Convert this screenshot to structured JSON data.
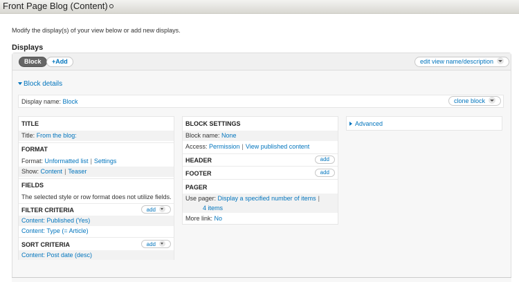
{
  "page": {
    "title": "Front Page Blog (Content)"
  },
  "intro_text": "Modify the display(s) of your view below or add new displays.",
  "displays_heading": "Displays",
  "tabs": {
    "active": "Block",
    "add_label": "+Add"
  },
  "edit_view_label": "edit view name/description",
  "block_details_label": "Block details",
  "display_name": {
    "label": "Display name:",
    "value": "Block"
  },
  "clone_label": "clone block",
  "col1": {
    "title_heading": "TITLE",
    "title_label": "Title:",
    "title_value": "From the blog:",
    "format_heading": "FORMAT",
    "format_label": "Format:",
    "format_value": "Unformatted list",
    "format_settings": "Settings",
    "show_label": "Show:",
    "show_value": "Content",
    "show_settings": "Teaser",
    "fields_heading": "FIELDS",
    "fields_note": "The selected style or row format does not utilize fields.",
    "filter_heading": "FILTER CRITERIA",
    "filter_items": [
      "Content: Published (Yes)",
      "Content: Type (= Article)"
    ],
    "sort_heading": "SORT CRITERIA",
    "sort_items": [
      "Content: Post date (desc)"
    ],
    "add_label": "add"
  },
  "col2": {
    "block_settings_heading": "BLOCK SETTINGS",
    "block_name_label": "Block name:",
    "block_name_value": "None",
    "access_label": "Access:",
    "access_value": "Permission",
    "access_setting": "View published content",
    "header_heading": "HEADER",
    "footer_heading": "FOOTER",
    "pager_heading": "PAGER",
    "use_pager_label": "Use pager:",
    "use_pager_value": "Display a specified number of items",
    "use_pager_count": "4 items",
    "more_link_label": "More link:",
    "more_link_value": "No",
    "add_label": "add"
  },
  "col3": {
    "advanced_label": "Advanced"
  }
}
